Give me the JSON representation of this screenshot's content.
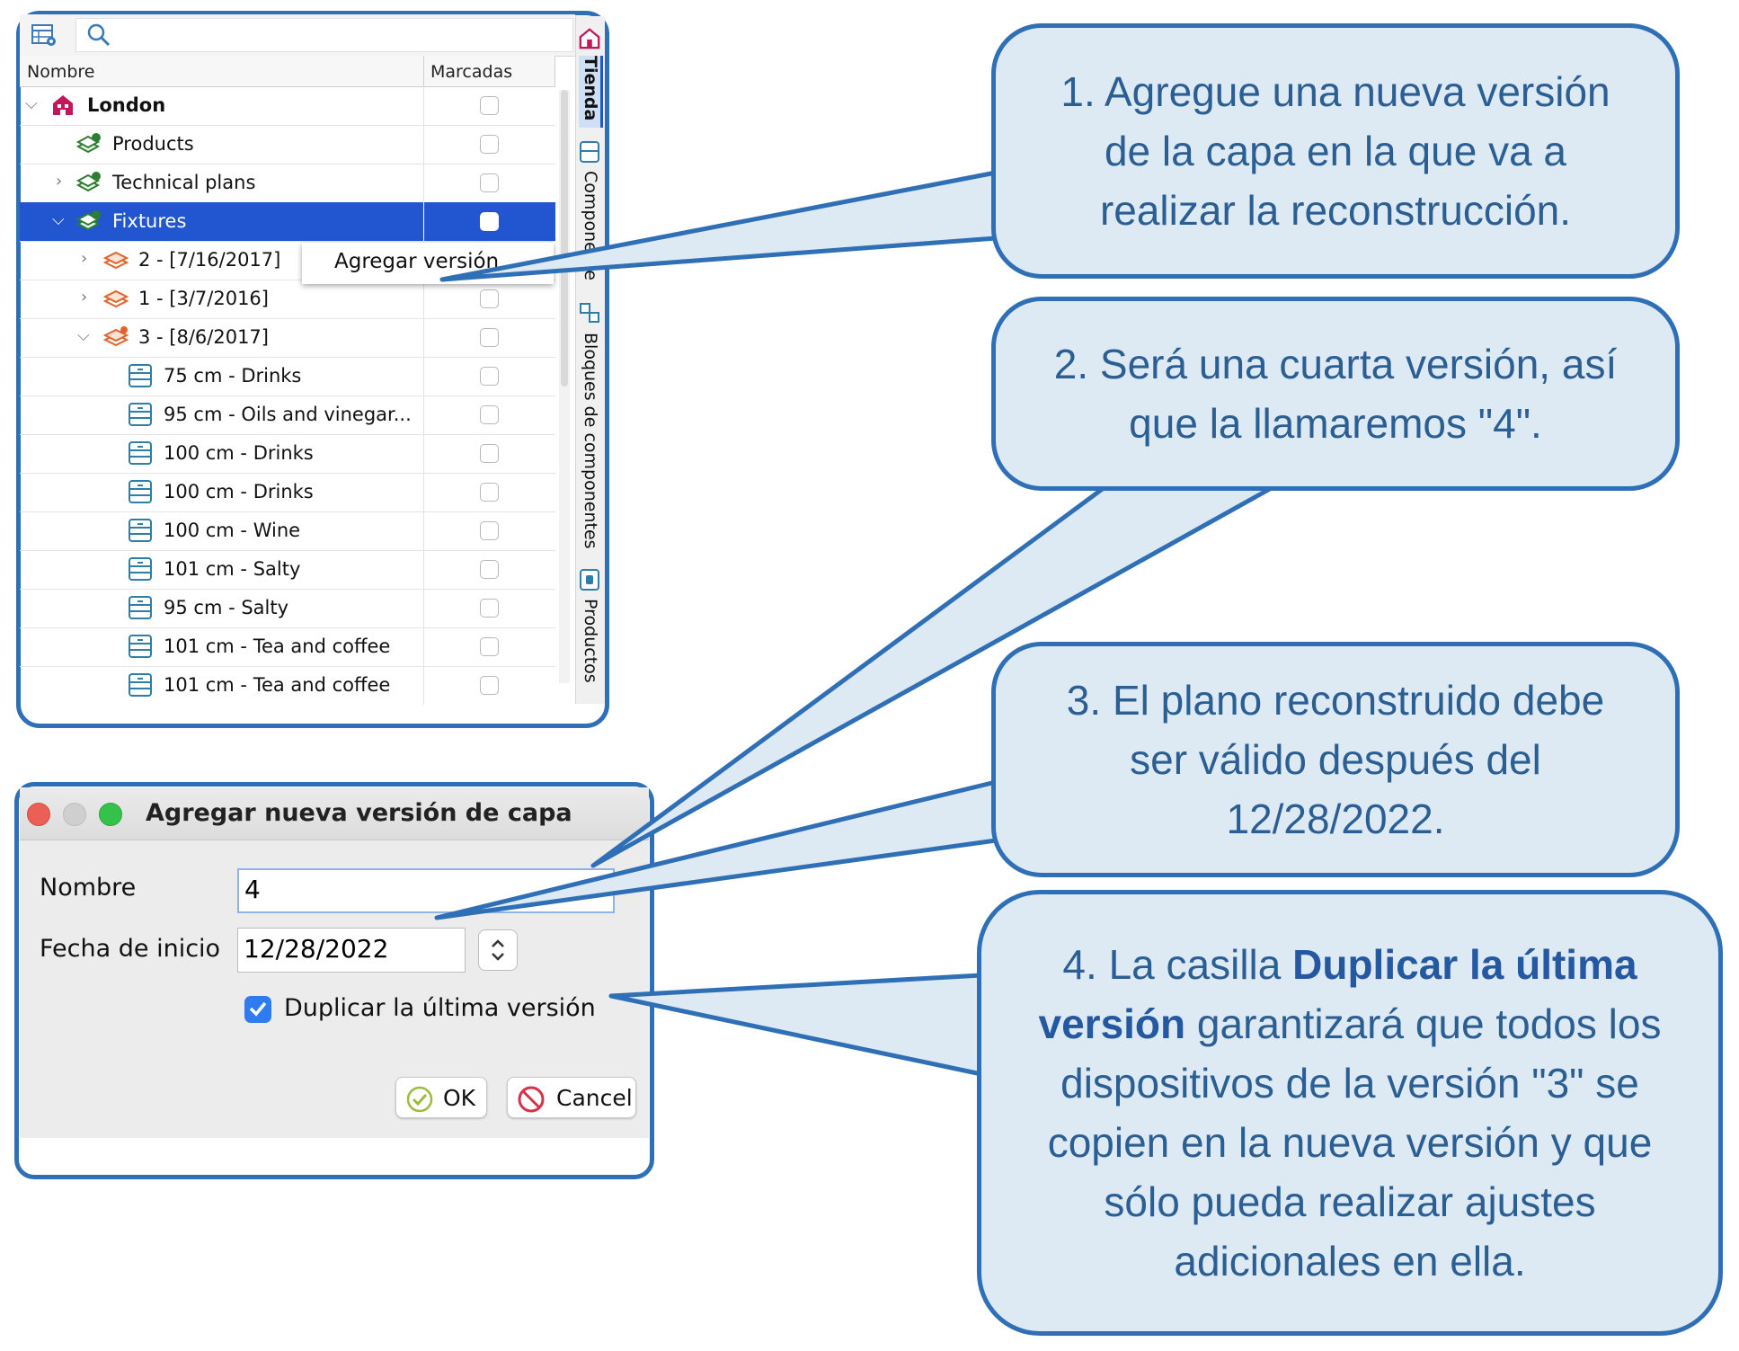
{
  "tree": {
    "columns": {
      "name": "Nombre",
      "marked": "Marcadas"
    },
    "rows": [
      {
        "label": "London",
        "bold": true
      },
      {
        "label": "Products"
      },
      {
        "label": "Technical plans"
      },
      {
        "label": "Fixtures",
        "selected": true
      },
      {
        "label": "2 - [7/16/2017]"
      },
      {
        "label": "1 - [3/7/2016]"
      },
      {
        "label": "3 - [8/6/2017]"
      },
      {
        "label": "75 cm - Drinks"
      },
      {
        "label": "95 cm - Oils and vinegar..."
      },
      {
        "label": "100 cm - Drinks"
      },
      {
        "label": "100 cm - Drinks"
      },
      {
        "label": "100 cm - Wine"
      },
      {
        "label": "101 cm - Salty"
      },
      {
        "label": "95 cm - Salty"
      },
      {
        "label": "101 cm - Tea and coffee"
      },
      {
        "label": "101 cm - Tea and coffee"
      }
    ],
    "side_tabs": {
      "store": "Tienda",
      "components": "Componente",
      "blocks": "Bloques de componentes",
      "products": "Productos"
    },
    "context_menu": {
      "add_version": "Agregar versión"
    }
  },
  "dialog": {
    "title": "Agregar nueva versión de capa",
    "name_label": "Nombre",
    "name_value": "4",
    "start_label": "Fecha de inicio",
    "start_value": "12/28/2022",
    "duplicate_label": "Duplicar la última versión",
    "duplicate_checked": true,
    "ok_label": "OK",
    "cancel_label": "Cancel"
  },
  "callouts": {
    "c1": {
      "text": "1. Agregue una nueva versión de la capa en la que va a realizar la reconstrucción."
    },
    "c2": {
      "text": "2. Será una cuarta versión, así que la llamaremos \"4\"."
    },
    "c3": {
      "text": "3. El plano reconstruido debe ser válido después del 12/28/2022."
    },
    "c4": {
      "prefix": "4. La casilla ",
      "bold": "Duplicar la última versión",
      "suffix": " garantizará que todos los dispositivos de la versión \"3\" se copien en la nueva versión y que sólo pueda realizar ajustes adicionales en ella."
    }
  },
  "colors": {
    "accent": "#2f6fb5",
    "callout_fill": "#dde9f3",
    "callout_text": "#2b5f93",
    "selection": "#2256d1"
  }
}
